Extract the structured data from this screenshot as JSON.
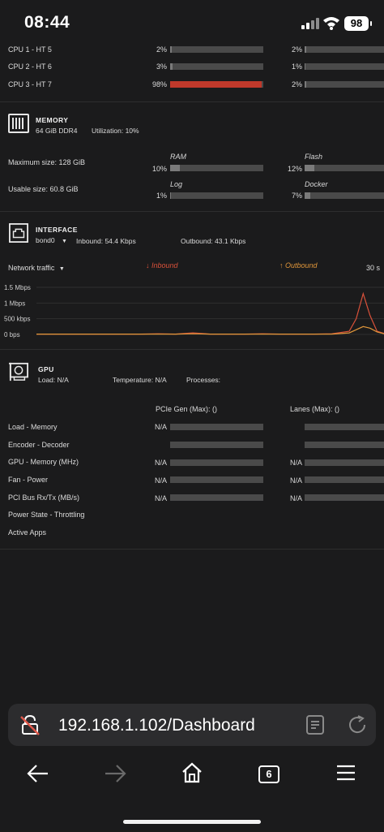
{
  "status": {
    "time": "08:44",
    "battery": "98"
  },
  "cpu": {
    "rows": [
      {
        "label": "CPU 1 - HT 5",
        "left_pct": "2%",
        "left_value": 2,
        "right_pct": "2%",
        "right_value": 2
      },
      {
        "label": "CPU 2 - HT 6",
        "left_pct": "3%",
        "left_value": 3,
        "right_pct": "1%",
        "right_value": 1
      },
      {
        "label": "CPU 3 - HT 7",
        "left_pct": "98%",
        "left_value": 98,
        "right_pct": "2%",
        "right_value": 2
      }
    ]
  },
  "memory": {
    "title": "MEMORY",
    "size": "64 GiB DDR4",
    "utilization": "Utilization: 10%",
    "max_size": "Maximum size: 128 GiB",
    "usable_size": "Usable size: 60.8 GiB",
    "bars": {
      "ram": {
        "label": "RAM",
        "pct": "10%",
        "value": 10
      },
      "flash": {
        "label": "Flash",
        "pct": "12%",
        "value": 12
      },
      "log": {
        "label": "Log",
        "pct": "1%",
        "value": 1
      },
      "docker": {
        "label": "Docker",
        "pct": "7%",
        "value": 7
      }
    }
  },
  "interface": {
    "title": "INTERFACE",
    "name": "bond0",
    "inbound": "Inbound: 54.4 Kbps",
    "outbound": "Outbound: 43.1 Kbps",
    "traffic_label": "Network traffic",
    "inbound_legend": "Inbound",
    "outbound_legend": "Outbound",
    "timespan": "30 s",
    "colors": {
      "inbound": "#d9513a",
      "outbound": "#e0963a"
    }
  },
  "chart_data": {
    "type": "line",
    "title": "",
    "xlabel": "",
    "ylabel": "",
    "y_ticks": [
      "1.5 Mbps",
      "1 Mbps",
      "500 kbps",
      "0 bps"
    ],
    "ylim": [
      0,
      1.5
    ],
    "x": [
      0,
      5,
      10,
      15,
      20,
      25,
      30,
      35,
      40,
      45,
      50,
      55,
      60,
      65,
      70,
      75,
      80,
      85,
      90,
      92,
      94,
      96,
      98,
      100
    ],
    "series": [
      {
        "name": "Inbound",
        "color": "#d9513a",
        "values": [
          0.01,
          0.01,
          0.01,
          0.01,
          0.01,
          0.01,
          0.01,
          0.02,
          0.01,
          0.05,
          0.01,
          0.01,
          0.01,
          0.02,
          0.01,
          0.01,
          0.01,
          0.02,
          0.1,
          0.5,
          1.3,
          0.6,
          0.1,
          0.03
        ]
      },
      {
        "name": "Outbound",
        "color": "#e0963a",
        "values": [
          0.01,
          0.01,
          0.01,
          0.01,
          0.01,
          0.01,
          0.01,
          0.01,
          0.01,
          0.02,
          0.01,
          0.01,
          0.01,
          0.01,
          0.01,
          0.01,
          0.01,
          0.01,
          0.05,
          0.15,
          0.25,
          0.2,
          0.08,
          0.02
        ]
      }
    ]
  },
  "gpu": {
    "title": "GPU",
    "load": "Load: N/A",
    "temperature": "Temperature: N/A",
    "processes": "Processes:",
    "pcie": "PCIe Gen (Max):  ()",
    "lanes": "Lanes (Max):  ()",
    "rows": [
      {
        "label": "Load - Memory",
        "left": "N/A",
        "right": "",
        "has_left_value": true
      },
      {
        "label": "Encoder - Decoder",
        "left": "",
        "right": "",
        "has_left_value": false
      },
      {
        "label": "GPU - Memory (MHz)",
        "left": "N/A",
        "right": "N/A",
        "has_left_value": true
      },
      {
        "label": "Fan - Power",
        "left": "N/A",
        "right": "N/A",
        "has_left_value": true
      },
      {
        "label": "PCI Bus Rx/Tx (MB/s)",
        "left": "N/A",
        "right": "N/A",
        "has_left_value": true
      }
    ],
    "power_state": "Power State - Throttling",
    "active_apps": "Active Apps"
  },
  "browser": {
    "url": "192.168.1.102/Dashboard",
    "tab_count": "6"
  }
}
